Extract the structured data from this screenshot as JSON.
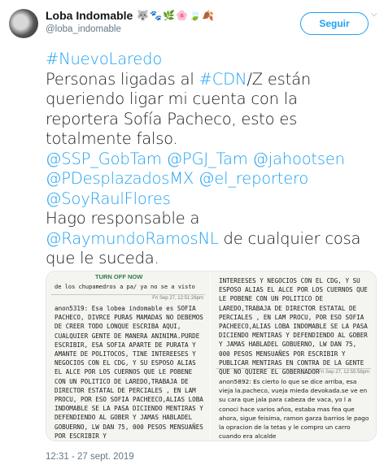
{
  "user": {
    "display_name": "Loba Indomable",
    "handle": "@loba_indomable",
    "emojis": [
      {
        "name": "wolf-emoji",
        "glyph": "🐺"
      },
      {
        "name": "paw-emoji",
        "glyph": "🐾"
      },
      {
        "name": "herb-emoji",
        "glyph": "🌿"
      },
      {
        "name": "blossom-emoji",
        "glyph": "🌸"
      },
      {
        "name": "leaf-emoji",
        "glyph": "🍃"
      },
      {
        "name": "fallen-leaf-emoji",
        "glyph": "🍂"
      }
    ]
  },
  "follow_button": "Seguir",
  "tweet": {
    "lines": [
      [
        {
          "t": "#NuevoLaredo",
          "link": true
        }
      ],
      [
        {
          "t": "Personas ligadas al ",
          "link": false
        },
        {
          "t": "#CDN",
          "link": true
        },
        {
          "t": "/Z están",
          "link": false
        }
      ],
      [
        {
          "t": "queriendo ligar mi cuenta con la",
          "link": false
        }
      ],
      [
        {
          "t": "reportera Sofía Pacheco, esto es",
          "link": false
        }
      ],
      [
        {
          "t": "totalmente falso.",
          "link": false
        }
      ],
      [
        {
          "t": "@SSP_GobTam",
          "link": true
        },
        {
          "t": " ",
          "link": false
        },
        {
          "t": "@PGJ_Tam",
          "link": true
        },
        {
          "t": " ",
          "link": false
        },
        {
          "t": "@jahootsen",
          "link": true
        }
      ],
      [
        {
          "t": "@PDesplazadosMX",
          "link": true
        },
        {
          "t": " ",
          "link": false
        },
        {
          "t": "@el_reportero",
          "link": true
        }
      ],
      [
        {
          "t": "@SoyRaulFlores",
          "link": true
        }
      ],
      [
        {
          "t": "Hago responsable a",
          "link": false
        }
      ],
      [
        {
          "t": "@RaymundoRamosNL",
          "link": true
        },
        {
          "t": " de cualquier cosa",
          "link": false
        }
      ],
      [
        {
          "t": "que le suceda.",
          "link": false
        }
      ]
    ]
  },
  "media": {
    "left": {
      "turn_off": "TURN OFF NOW",
      "top_text": "de los chupamedros a pa/ ya no se a visto",
      "stamp1": "Fri Sep 27, 12:51:26pm",
      "body": "anon5319: Esa lobea indomable es SOFIA PACHECO, DIVRCE PURAS MAMADAS NO DEBEMOS DE CREER TODO LONQUE ESCRIBA AQUI, CUALQUIER GENTE DE MANERA ANINIMA.PURDE ESCRIBIR, ESA SOFIA APARTE DE PURATA Y AMANTE DE POLITOCOS, TINE INTEREESES Y NEGOCIOS CON EL CDG, Y SU ESPOSO ALIAS EL ALCE POR LOS CUERNOS QUE LE POBENE CON UN POLITICO DE LAREDO,TRABAJA DE DIRECTOR ESTATAL DE PERCIALES , EN LAM PROCU, POR ESO SOFIA PACHEECO,ALIAS LOBA INDOMABLE SE LA PASA DICIENDO MENTIRAS Y DEFENDIENDO AL GOBER Y JAMAS HABLADEL GOBUERNO, LW DAN 75, 000 PESOS MENSUAÑES POR ESCRIBIR Y"
    },
    "right": {
      "body": "INTEREESES Y NEGOCIOS CON EL CDG, Y SU ESPOSO ALIAS EL ALCE POR LOS CUERNOS QUE LE POBENE CON UN POLITICO DE LAREDO,TRABAJA DE DIRECTOR ESTATAL DE PERCIALES , EN LAM PROCU, POR ESO SOFIA PACHEECO,ALIAS LOBA INDOMABLE SE LA PASA DICIENDO MENTIRAS Y DEFENDIENDO AL GOBER Y JAMAS HABLADEL GOBUERNO, LW DAN 75, 000 PESOS MENSUAÑES POR ESCRIBIR Y PUBLICAR MENTIRAS EN CONTRA DE LA GENTE QUE NO QUIERE EL GOBERNADOR",
      "stamp1": "Fri Sep 27, 12:55:58pm",
      "body2": "anon5892: Es cierto lo que se dice arriba, esa vieja la.pacheco, vueja mieda devokada.se ve en su cara que jala para cabeza de vaca, yo l a conoci hace varios años, estaba mas fea que ahora, sigue feisima, ramon garza barrios le pago la opracion de la tetas y le compro un carro cuando era alcalde"
    }
  },
  "timestamp": "12:31 - 27 sept. 2019"
}
